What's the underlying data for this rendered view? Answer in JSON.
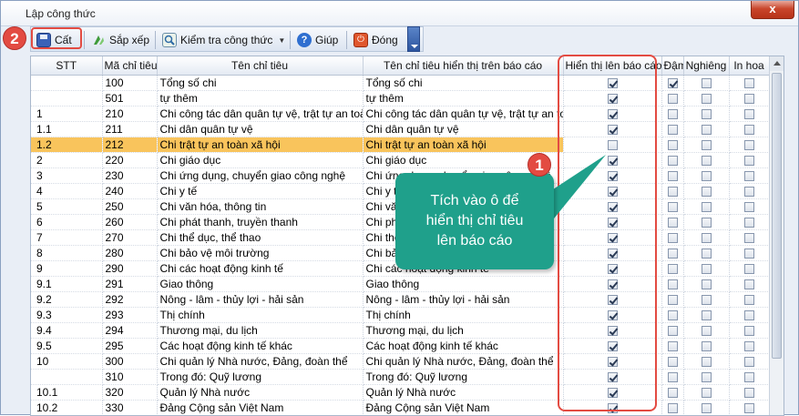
{
  "window": {
    "title": "Lập công thức",
    "close_label": "x"
  },
  "toolbar": {
    "cut_label": "Cất",
    "sort_label": "Sắp xếp",
    "check_formula_label": "Kiểm tra công thức",
    "help_label": "Giúp",
    "close_label": "Đóng"
  },
  "grid": {
    "headers": [
      "STT",
      "Mã chỉ tiêu",
      "Tên chỉ tiêu",
      "Tên chỉ tiêu hiển thị trên báo cáo",
      "Hiển thị lên báo cáo",
      "Đậm",
      "Nghiêng",
      "In hoa"
    ],
    "rows": [
      {
        "stt": "",
        "code": "100",
        "name": "Tổng số chi",
        "display": "Tổng số chi",
        "show": true,
        "bold": true,
        "italic": false,
        "upper": false,
        "selected": false
      },
      {
        "stt": "",
        "code": "501",
        "name": "tự thêm",
        "display": "tự thêm",
        "show": true,
        "bold": false,
        "italic": false,
        "upper": false,
        "selected": false
      },
      {
        "stt": "1",
        "code": "210",
        "name": "Chi công tác dân quân tự vệ, trật tự an toà...",
        "display": "Chi công tác dân quân tự vệ, trật tự an to...",
        "show": true,
        "bold": false,
        "italic": false,
        "upper": false,
        "selected": false
      },
      {
        "stt": "1.1",
        "code": "211",
        "name": "Chi dân quân tự vệ",
        "display": "Chi dân quân tự vệ",
        "show": true,
        "bold": false,
        "italic": false,
        "upper": false,
        "selected": false
      },
      {
        "stt": "1.2",
        "code": "212",
        "name": "Chi trật tự an toàn xã hội",
        "display": "Chi trật tự an toàn xã hội",
        "show": false,
        "bold": false,
        "italic": false,
        "upper": false,
        "selected": true
      },
      {
        "stt": "2",
        "code": "220",
        "name": "Chi giáo dục",
        "display": "Chi giáo dục",
        "show": true,
        "bold": false,
        "italic": false,
        "upper": false,
        "selected": false
      },
      {
        "stt": "3",
        "code": "230",
        "name": "Chi ứng dụng, chuyển giao công nghệ",
        "display": "Chi ứng dụng, chuyển giao công nghệ",
        "show": true,
        "bold": false,
        "italic": false,
        "upper": false,
        "selected": false
      },
      {
        "stt": "4",
        "code": "240",
        "name": "Chi y tế",
        "display": "Chi y tế",
        "show": true,
        "bold": false,
        "italic": false,
        "upper": false,
        "selected": false
      },
      {
        "stt": "5",
        "code": "250",
        "name": "Chi văn hóa, thông tin",
        "display": "Chi văn hóa, thông tin",
        "show": true,
        "bold": false,
        "italic": false,
        "upper": false,
        "selected": false
      },
      {
        "stt": "6",
        "code": "260",
        "name": "Chi phát thanh, truyền thanh",
        "display": "Chi phát thanh, truyền thanh",
        "show": true,
        "bold": false,
        "italic": false,
        "upper": false,
        "selected": false
      },
      {
        "stt": "7",
        "code": "270",
        "name": "Chi thể dục, thể thao",
        "display": "Chi thể dục, thể thao",
        "show": true,
        "bold": false,
        "italic": false,
        "upper": false,
        "selected": false
      },
      {
        "stt": "8",
        "code": "280",
        "name": "Chi bảo vệ môi trường",
        "display": "Chi bảo vệ môi trường",
        "show": true,
        "bold": false,
        "italic": false,
        "upper": false,
        "selected": false
      },
      {
        "stt": "9",
        "code": "290",
        "name": "Chi các hoạt động kinh tế",
        "display": "Chi các hoạt động kinh tế",
        "show": true,
        "bold": false,
        "italic": false,
        "upper": false,
        "selected": false
      },
      {
        "stt": "9.1",
        "code": "291",
        "name": "Giao thông",
        "display": "Giao thông",
        "show": true,
        "bold": false,
        "italic": false,
        "upper": false,
        "selected": false
      },
      {
        "stt": "9.2",
        "code": "292",
        "name": "Nông - lâm - thủy lợi - hải sản",
        "display": "Nông - lâm - thủy lợi - hải sản",
        "show": true,
        "bold": false,
        "italic": false,
        "upper": false,
        "selected": false
      },
      {
        "stt": "9.3",
        "code": "293",
        "name": "Thị chính",
        "display": "Thị chính",
        "show": true,
        "bold": false,
        "italic": false,
        "upper": false,
        "selected": false
      },
      {
        "stt": "9.4",
        "code": "294",
        "name": "Thương mại, du lịch",
        "display": "Thương mại, du lịch",
        "show": true,
        "bold": false,
        "italic": false,
        "upper": false,
        "selected": false
      },
      {
        "stt": "9.5",
        "code": "295",
        "name": "Các hoạt động kinh tế khác",
        "display": "Các hoạt động kinh tế khác",
        "show": true,
        "bold": false,
        "italic": false,
        "upper": false,
        "selected": false
      },
      {
        "stt": "10",
        "code": "300",
        "name": "Chi quản lý Nhà nước, Đảng, đoàn thể",
        "display": "Chi quản lý Nhà nước, Đảng, đoàn thể",
        "show": true,
        "bold": false,
        "italic": false,
        "upper": false,
        "selected": false
      },
      {
        "stt": "",
        "code": "310",
        "name": "Trong đó: Quỹ lương",
        "display": "Trong đó: Quỹ lương",
        "show": true,
        "bold": false,
        "italic": false,
        "upper": false,
        "selected": false
      },
      {
        "stt": "10.1",
        "code": "320",
        "name": "Quản lý Nhà nước",
        "display": "Quản lý Nhà nước",
        "show": true,
        "bold": false,
        "italic": false,
        "upper": false,
        "selected": false
      },
      {
        "stt": "10.2",
        "code": "330",
        "name": "Đảng Cộng sản Việt Nam",
        "display": "Đảng Cộng sản Việt Nam",
        "show": true,
        "bold": false,
        "italic": false,
        "upper": false,
        "selected": false
      }
    ]
  },
  "annotations": {
    "badge_1": "1",
    "badge_2": "2",
    "callout_lines": [
      "Tích vào ô để",
      "hiển thị chỉ tiêu",
      "lên báo cáo"
    ]
  },
  "colors": {
    "selected_row": "#f9c45c",
    "annotation_red": "#e34b42",
    "callout_teal": "#1fa08b"
  }
}
